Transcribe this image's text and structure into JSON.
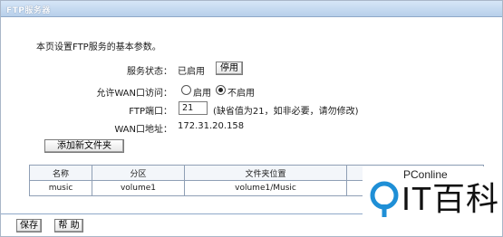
{
  "window": {
    "title": "FTP服务器"
  },
  "intro": "本页设置FTP服务的基本参数。",
  "service_status": {
    "label": "服务状态：",
    "value": "已启用",
    "button": "停用"
  },
  "wan_access": {
    "label": "允许WAN口访问：",
    "options": [
      "启用",
      "不启用"
    ],
    "selected": "不启用"
  },
  "ftp_port": {
    "label": "FTP端口：",
    "value": "21",
    "hint": "(缺省值为21，如非必要，请勿修改)"
  },
  "wan_address": {
    "label": "WAN口地址：",
    "value": "172.31.20.158"
  },
  "add_folder_button": "添加新文件夹",
  "table": {
    "headers": [
      "名称",
      "分区",
      "文件夹位置",
      ""
    ],
    "rows": [
      [
        "music",
        "volume1",
        "volume1/Music",
        ""
      ]
    ]
  },
  "footer": {
    "save": "保存",
    "help": "帮 助"
  },
  "watermark": {
    "small": "PConline",
    "big": "IT百科"
  },
  "colors": {
    "titlebar": "#b7cfea",
    "border": "#8fa8c8",
    "logo_blue": "#1f8fd6"
  }
}
